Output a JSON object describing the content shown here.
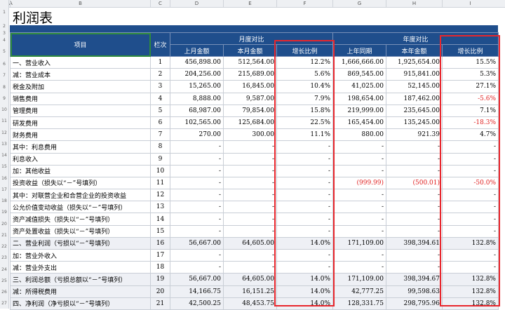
{
  "sheet": {
    "columns": [
      "A",
      "B",
      "C",
      "D",
      "E",
      "F",
      "G",
      "H",
      "I"
    ],
    "rows": [
      "1",
      "2",
      "3",
      "4",
      "5",
      "6",
      "7",
      "8",
      "9",
      "10",
      "11",
      "12",
      "13",
      "14",
      "15",
      "16",
      "17",
      "18",
      "19",
      "20",
      "21",
      "22",
      "23",
      "24",
      "25",
      "26",
      "27"
    ]
  },
  "report": {
    "title": "利润表",
    "header": {
      "item": "项目",
      "line": "栏次",
      "monthly_group": "月度对比",
      "yearly_group": "年度对比",
      "prev_month": "上月金额",
      "this_month": "本月金额",
      "monthly_growth": "增长比例",
      "prev_year": "上年同期",
      "this_year": "本年金额",
      "yearly_growth": "增长比例"
    },
    "rows": [
      {
        "item": "一、营业收入",
        "line": "1",
        "pm": "456,898.00",
        "tm": "512,564.00",
        "mg": "12.2%",
        "py": "1,666,666.00",
        "ty": "1,925,654.00",
        "yg": "15.5%"
      },
      {
        "item": "减：营业成本",
        "line": "2",
        "pm": "204,256.00",
        "tm": "215,689.00",
        "mg": "5.6%",
        "py": "869,545.00",
        "ty": "915,841.00",
        "yg": "5.3%"
      },
      {
        "item": "税金及附加",
        "line": "3",
        "pm": "15,265.00",
        "tm": "16,845.00",
        "mg": "10.4%",
        "py": "41,025.00",
        "ty": "52,145.00",
        "yg": "27.1%"
      },
      {
        "item": "销售费用",
        "line": "4",
        "pm": "8,888.00",
        "tm": "9,587.00",
        "mg": "7.9%",
        "py": "198,654.00",
        "ty": "187,462.00",
        "yg": "-5.6%"
      },
      {
        "item": "管理费用",
        "line": "5",
        "pm": "68,987.00",
        "tm": "79,854.00",
        "mg": "15.8%",
        "py": "219,999.00",
        "ty": "235,645.00",
        "yg": "7.1%"
      },
      {
        "item": "研发费用",
        "line": "6",
        "pm": "102,565.00",
        "tm": "125,684.00",
        "mg": "22.5%",
        "py": "165,454.00",
        "ty": "135,245.00",
        "yg": "-18.3%"
      },
      {
        "item": "财务费用",
        "line": "7",
        "pm": "270.00",
        "tm": "300.00",
        "mg": "11.1%",
        "py": "880.00",
        "ty": "921.39",
        "yg": "4.7%"
      },
      {
        "item": "其中：利息费用",
        "line": "8",
        "pm": "-",
        "tm": "-",
        "mg": "-",
        "py": "-",
        "ty": "-",
        "yg": "-"
      },
      {
        "item": "利息收入",
        "line": "9",
        "pm": "-",
        "tm": "-",
        "mg": "-",
        "py": "-",
        "ty": "-",
        "yg": "-"
      },
      {
        "item": "加：其他收益",
        "line": "10",
        "pm": "-",
        "tm": "-",
        "mg": "-",
        "py": "-",
        "ty": "-",
        "yg": "-"
      },
      {
        "item": "投资收益（损失以“－”号填列）",
        "line": "11",
        "pm": "-",
        "tm": "-",
        "mg": "-",
        "py": "(999.99)",
        "ty": "(500.01)",
        "yg": "-50.0%"
      },
      {
        "item": "其中：对联营企业和合营企业的投资收益",
        "line": "12",
        "pm": "-",
        "tm": "-",
        "mg": "-",
        "py": "-",
        "ty": "-",
        "yg": "-"
      },
      {
        "item": "公允价值变动收益（损失以“－”号填列）",
        "line": "13",
        "pm": "-",
        "tm": "-",
        "mg": "-",
        "py": "-",
        "ty": "-",
        "yg": "-"
      },
      {
        "item": "资产减值损失（损失以“－”号填列）",
        "line": "14",
        "pm": "-",
        "tm": "-",
        "mg": "-",
        "py": "-",
        "ty": "-",
        "yg": "-"
      },
      {
        "item": "资产处置收益（损失以“－”号填列）",
        "line": "15",
        "pm": "-",
        "tm": "-",
        "mg": "-",
        "py": "-",
        "ty": "-",
        "yg": "-"
      },
      {
        "item": "二、营业利润（亏损以“－”号填列）",
        "line": "16",
        "pm": "56,667.00",
        "tm": "64,605.00",
        "mg": "14.0%",
        "py": "171,109.00",
        "ty": "398,394.61",
        "yg": "132.8%"
      },
      {
        "item": "加：营业外收入",
        "line": "17",
        "pm": "-",
        "tm": "-",
        "mg": "-",
        "py": "-",
        "ty": "-",
        "yg": "-"
      },
      {
        "item": "减：营业外支出",
        "line": "18",
        "pm": "-",
        "tm": "-",
        "mg": "-",
        "py": "-",
        "ty": "-",
        "yg": "-"
      },
      {
        "item": "三、利润总额（亏损总额以“－”号填列）",
        "line": "19",
        "pm": "56,667.00",
        "tm": "64,605.00",
        "mg": "14.0%",
        "py": "171,109.00",
        "ty": "398,394.67",
        "yg": "132.8%"
      },
      {
        "item": "减：所得税费用",
        "line": "20",
        "pm": "14,166.75",
        "tm": "16,151.25",
        "mg": "14.0%",
        "py": "42,777.25",
        "ty": "99,598.63",
        "yg": "132.8%"
      },
      {
        "item": "四、净利润（净亏损以“－”号填列）",
        "line": "21",
        "pm": "42,500.25",
        "tm": "48,453.75",
        "mg": "14.0%",
        "py": "128,331.75",
        "ty": "298,795.96",
        "yg": "132.8%"
      }
    ]
  },
  "colors": {
    "header_bg": "#1f4e8c",
    "highlight_border": "#e8262c",
    "negative_text": "#e02020",
    "selection": "#2e8b3c"
  }
}
